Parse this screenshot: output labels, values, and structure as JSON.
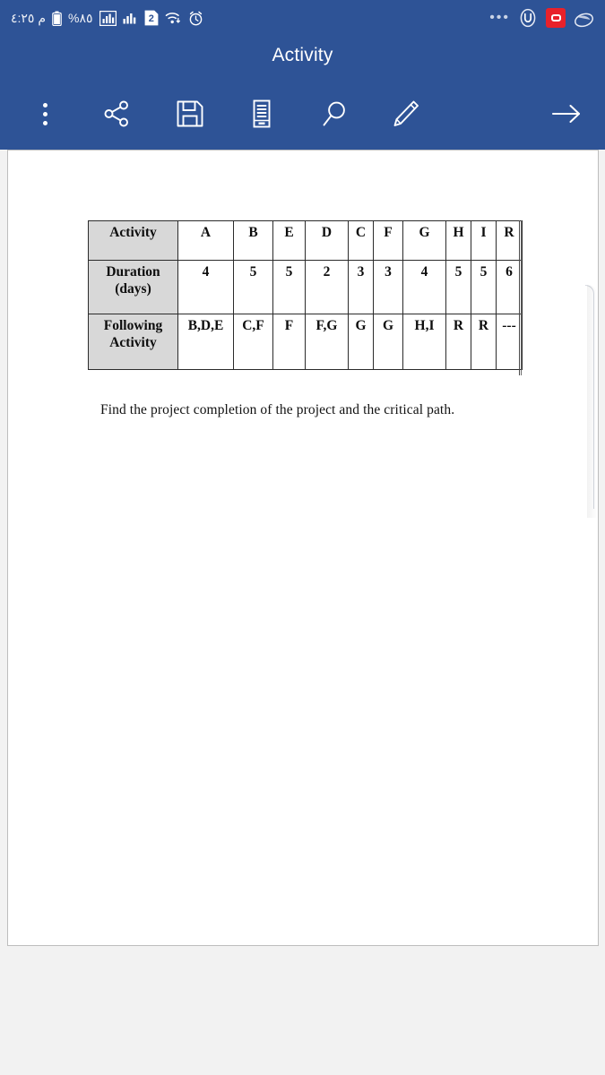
{
  "status_bar": {
    "time": "م ٤:٢٥",
    "battery_percent": "%٨٥",
    "sim_badge": "2",
    "icons": [
      "battery-icon",
      "signal-bars-icon",
      "signal-bars-secondary-icon",
      "sim-2-icon",
      "wifi-icon",
      "alarm-clock-icon"
    ],
    "right_icons": [
      "overflow-dots-icon",
      "u-circle-icon",
      "red-square-badge-icon",
      "saucer-icon"
    ],
    "accent_blue": "#2e5396",
    "badge_red": "#e8212a"
  },
  "appbar": {
    "title": "Activity",
    "toolbar": [
      {
        "name": "more-options-icon",
        "label": "More options"
      },
      {
        "name": "share-icon",
        "label": "Share"
      },
      {
        "name": "save-icon",
        "label": "Save"
      },
      {
        "name": "notes-icon",
        "label": "Notes"
      },
      {
        "name": "search-icon",
        "label": "Search"
      },
      {
        "name": "edit-icon",
        "label": "Edit"
      },
      {
        "name": "arrow-right-icon",
        "label": "Next"
      }
    ]
  },
  "document": {
    "table": {
      "rows": [
        {
          "label": "Activity",
          "cells": [
            "A",
            "B",
            "E",
            "D",
            "C",
            "F",
            "G",
            "H",
            "I",
            "R"
          ]
        },
        {
          "label": "Duration (days)",
          "label_line1": "Duration",
          "label_line2": "(days)",
          "cells": [
            "4",
            "5",
            "5",
            "2",
            "3",
            "3",
            "4",
            "5",
            "5",
            "6"
          ]
        },
        {
          "label": "Following Activity",
          "label_line1": "Following",
          "label_line2": "Activity",
          "cells": [
            "B,D,E",
            "C,F",
            "F",
            "F,G",
            "G",
            "G",
            "H,I",
            "R",
            "R",
            "---"
          ]
        }
      ]
    },
    "question": "Find the project completion of the project and the critical path."
  }
}
